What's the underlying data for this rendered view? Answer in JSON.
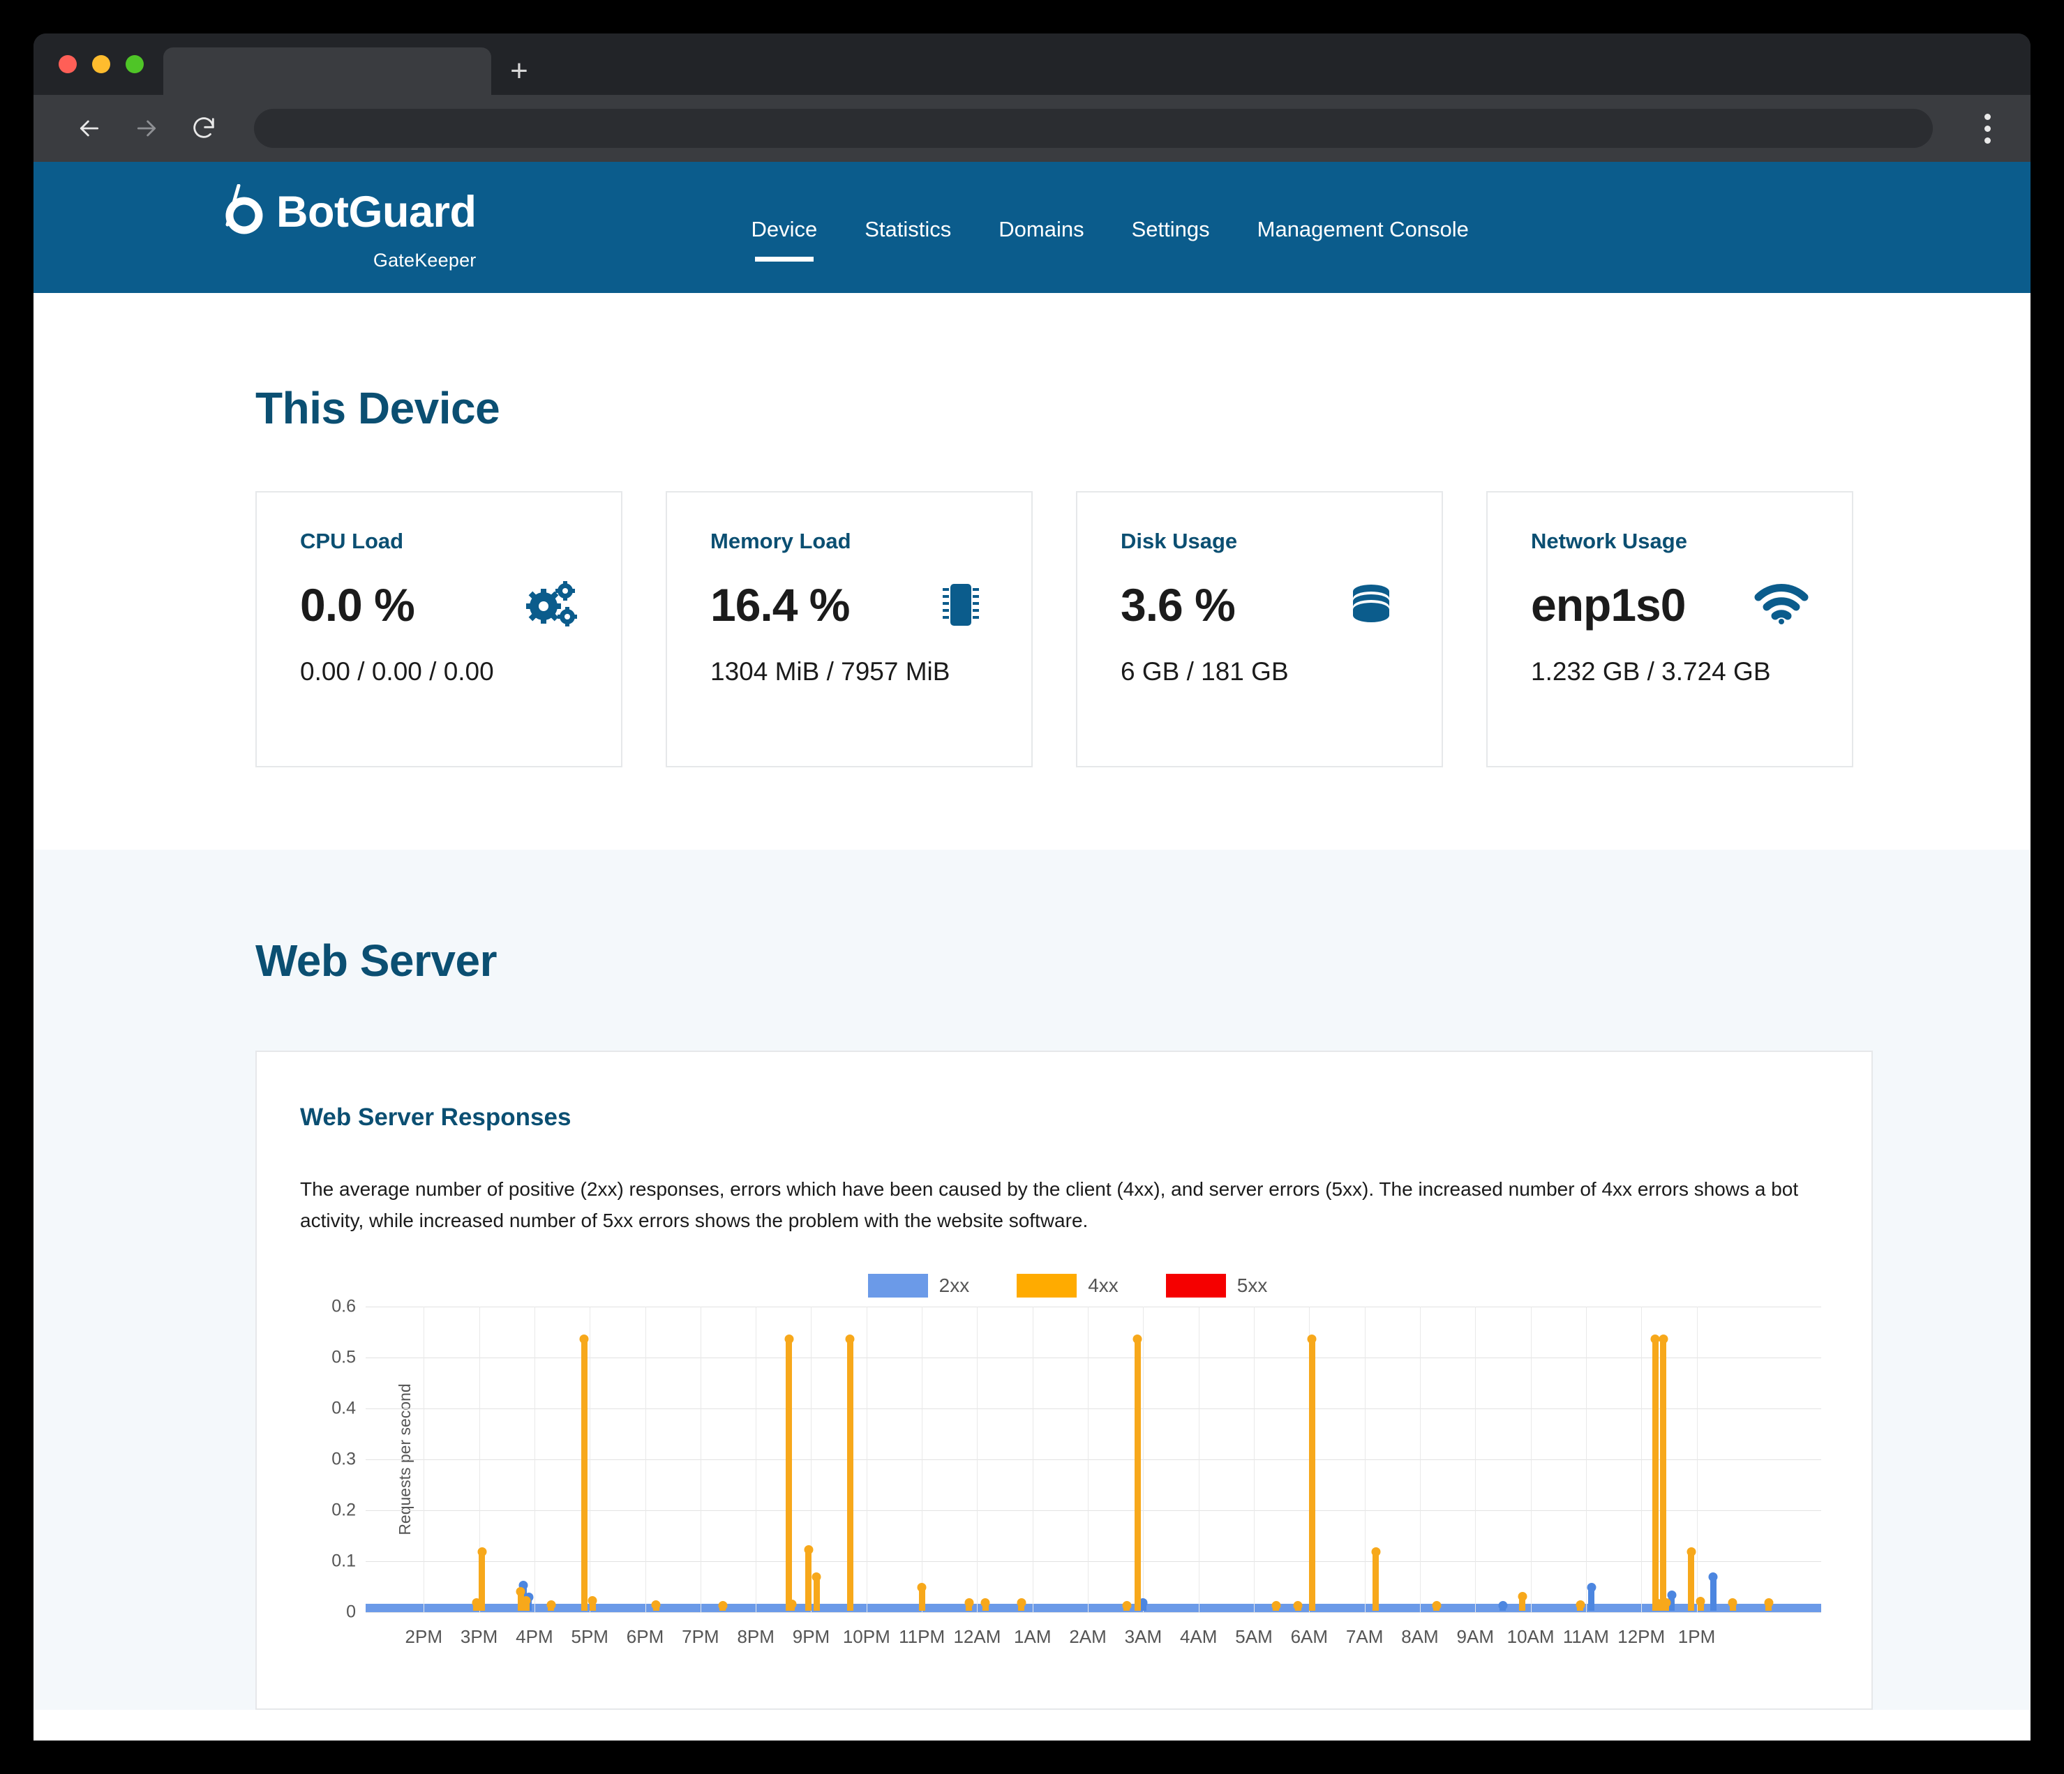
{
  "browser": {
    "tab_title": "",
    "url": "",
    "back_icon": "arrow-left-icon",
    "forward_icon": "arrow-right-icon",
    "reload_icon": "reload-icon",
    "menu_icon": "kebab-menu-icon",
    "new_tab_label": "+"
  },
  "header": {
    "brand_name": "BotGuard",
    "brand_sub": "GateKeeper",
    "brand_color": "#0b5c8c",
    "nav": [
      {
        "label": "Device",
        "active": true
      },
      {
        "label": "Statistics",
        "active": false
      },
      {
        "label": "Domains",
        "active": false
      },
      {
        "label": "Settings",
        "active": false
      },
      {
        "label": "Management Console",
        "active": false
      }
    ]
  },
  "device": {
    "title": "This Device",
    "cards": [
      {
        "title": "CPU Load",
        "value": "0.0 %",
        "sub": "0.00 / 0.00 / 0.00",
        "icon": "gears-icon"
      },
      {
        "title": "Memory Load",
        "value": "16.4 %",
        "sub": "1304 MiB / 7957 MiB",
        "icon": "memory-chip-icon"
      },
      {
        "title": "Disk Usage",
        "value": "3.6 %",
        "sub": "6 GB / 181 GB",
        "icon": "database-icon"
      },
      {
        "title": "Network Usage",
        "value": "enp1s0",
        "sub": "1.232 GB / 3.724 GB",
        "icon": "wifi-icon"
      }
    ]
  },
  "webserver": {
    "title": "Web Server",
    "panel_title": "Web Server Responses",
    "description": "The average number of positive (2xx) responses, errors which have been caused by the client (4xx), and server errors (5xx). The increased number of 4xx errors shows a bot activity, while increased number of 5xx errors shows the problem with the website software."
  },
  "chart_data": {
    "type": "line",
    "title": "Web Server Responses",
    "xlabel": "",
    "ylabel": "Requests per second",
    "ylim": [
      0,
      0.6
    ],
    "yticks": [
      0,
      0.1,
      0.2,
      0.3,
      0.4,
      0.5,
      0.6
    ],
    "ytick_labels": [
      "0",
      "0.1",
      "0.2",
      "0.3",
      "0.4",
      "0.5",
      "0.6"
    ],
    "grid": true,
    "legend_position": "top-center",
    "x": [
      "2PM",
      "3PM",
      "4PM",
      "5PM",
      "6PM",
      "7PM",
      "8PM",
      "9PM",
      "10PM",
      "11PM",
      "12AM",
      "1AM",
      "2AM",
      "3AM",
      "4AM",
      "5AM",
      "6AM",
      "7AM",
      "8AM",
      "9AM",
      "10AM",
      "11AM",
      "12PM",
      "1PM"
    ],
    "series": [
      {
        "name": "2xx",
        "color": "#4c86e0",
        "baseline": 0.004,
        "points": [
          {
            "x": 2.85,
            "y": 0.052
          },
          {
            "x": 2.95,
            "y": 0.028
          },
          {
            "x": 14.05,
            "y": 0.018
          },
          {
            "x": 20.55,
            "y": 0.012
          },
          {
            "x": 22.15,
            "y": 0.048
          },
          {
            "x": 23.6,
            "y": 0.032
          },
          {
            "x": 24.35,
            "y": 0.068
          }
        ]
      },
      {
        "name": "4xx",
        "color": "#f7a81b",
        "points": [
          {
            "x": 2.1,
            "y": 0.118
          },
          {
            "x": 2.0,
            "y": 0.018
          },
          {
            "x": 2.8,
            "y": 0.04
          },
          {
            "x": 2.9,
            "y": 0.022
          },
          {
            "x": 3.35,
            "y": 0.014
          },
          {
            "x": 3.95,
            "y": 0.535
          },
          {
            "x": 4.1,
            "y": 0.022
          },
          {
            "x": 5.25,
            "y": 0.014
          },
          {
            "x": 6.45,
            "y": 0.012
          },
          {
            "x": 7.65,
            "y": 0.535
          },
          {
            "x": 7.7,
            "y": 0.015
          },
          {
            "x": 8.0,
            "y": 0.122
          },
          {
            "x": 8.15,
            "y": 0.068
          },
          {
            "x": 8.75,
            "y": 0.535
          },
          {
            "x": 10.05,
            "y": 0.048
          },
          {
            "x": 10.9,
            "y": 0.018
          },
          {
            "x": 11.2,
            "y": 0.018
          },
          {
            "x": 11.85,
            "y": 0.018
          },
          {
            "x": 13.95,
            "y": 0.535
          },
          {
            "x": 13.75,
            "y": 0.012
          },
          {
            "x": 16.45,
            "y": 0.012
          },
          {
            "x": 16.85,
            "y": 0.012
          },
          {
            "x": 17.1,
            "y": 0.535
          },
          {
            "x": 18.25,
            "y": 0.118
          },
          {
            "x": 19.35,
            "y": 0.012
          },
          {
            "x": 20.9,
            "y": 0.03
          },
          {
            "x": 21.95,
            "y": 0.014
          },
          {
            "x": 23.3,
            "y": 0.535
          },
          {
            "x": 23.45,
            "y": 0.535
          },
          {
            "x": 23.35,
            "y": 0.016
          },
          {
            "x": 23.5,
            "y": 0.018
          },
          {
            "x": 23.95,
            "y": 0.117
          },
          {
            "x": 24.12,
            "y": 0.02
          },
          {
            "x": 24.7,
            "y": 0.018
          },
          {
            "x": 25.35,
            "y": 0.018
          }
        ]
      },
      {
        "name": "5xx",
        "color": "#f50000",
        "points": []
      }
    ],
    "legend": [
      {
        "label": "2xx",
        "color": "#6b9ae8"
      },
      {
        "label": "4xx",
        "color": "#ffab00"
      },
      {
        "label": "5xx",
        "color": "#f50000"
      }
    ]
  }
}
